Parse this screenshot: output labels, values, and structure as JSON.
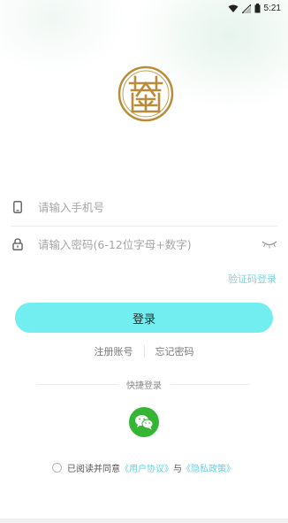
{
  "status_bar": {
    "time": "5:21",
    "icons": [
      "wifi-icon",
      "signal-icon",
      "battery-icon"
    ]
  },
  "logo": {
    "icon": "seal-logo-icon",
    "color": "#b88c3a"
  },
  "phone_field": {
    "icon": "phone-icon",
    "placeholder": "请输入手机号",
    "value": ""
  },
  "password_field": {
    "icon": "lock-icon",
    "placeholder": "请输入密码(6-12位字母+数字)",
    "value": "",
    "toggle_icon": "eye-closed-icon"
  },
  "sms_login_link": "验证码登录",
  "login_button": "登录",
  "links": {
    "register": "注册账号",
    "forgot": "忘记密码"
  },
  "quick_login": {
    "label": "快捷登录",
    "wechat_icon": "wechat-icon"
  },
  "agreement": {
    "prefix": "已阅读并同意",
    "user_agreement": "《用户协议》",
    "conjunction": "与",
    "privacy_policy": "《隐私政策》"
  },
  "colors": {
    "accent": "#72eef0",
    "link": "#62d3e2",
    "wechat": "#35b534",
    "logo": "#b88c3a"
  }
}
